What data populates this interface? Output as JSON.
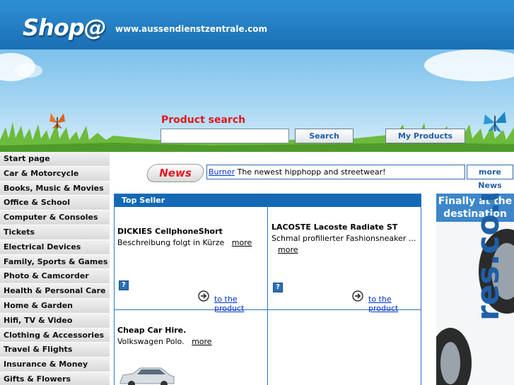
{
  "header": {
    "logo": "Shop@",
    "domain": "www.aussendienstzentrale.com"
  },
  "search": {
    "title": "Product search",
    "placeholder": "",
    "button": "Search",
    "my_products": "My Products"
  },
  "sidebar": {
    "items": [
      "Start page",
      "Car & Motorcycle",
      "Books, Music & Movies",
      "Office & School",
      "Computer & Consoles",
      "Tickets",
      "Electrical Devices",
      "Family, Sports & Games",
      "Photo & Camcorder",
      "Health & Personal Care",
      "Home & Garden",
      "Hifi, TV & Video",
      "Clothing & Accessories",
      "Travel & Flights",
      "Insurance & Money",
      "Gifts & Flowers"
    ]
  },
  "news": {
    "badge": "News",
    "link": "Burner",
    "text": " The newest hipphopp and streetwear!",
    "more": "more News"
  },
  "topseller": {
    "header": "Top Seller",
    "products": [
      {
        "title": "DICKIES CellphoneShort",
        "desc": "Beschreibung folgt in Kürze",
        "more": "more",
        "link": "to the product"
      },
      {
        "title": "LACOSTE Lacoste Radiate ST",
        "desc": "Schmal profilierter Fashionsneaker ...",
        "more": "more",
        "link": "to the product"
      },
      {
        "title": "Cheap Car Hire.",
        "desc": "Volkswagen Polo.",
        "more": "more"
      }
    ],
    "help_glyph": "?"
  },
  "ad": {
    "headline_1": "Finally at the",
    "headline_2": "destination",
    "rotated_text": "res.co.uk"
  }
}
